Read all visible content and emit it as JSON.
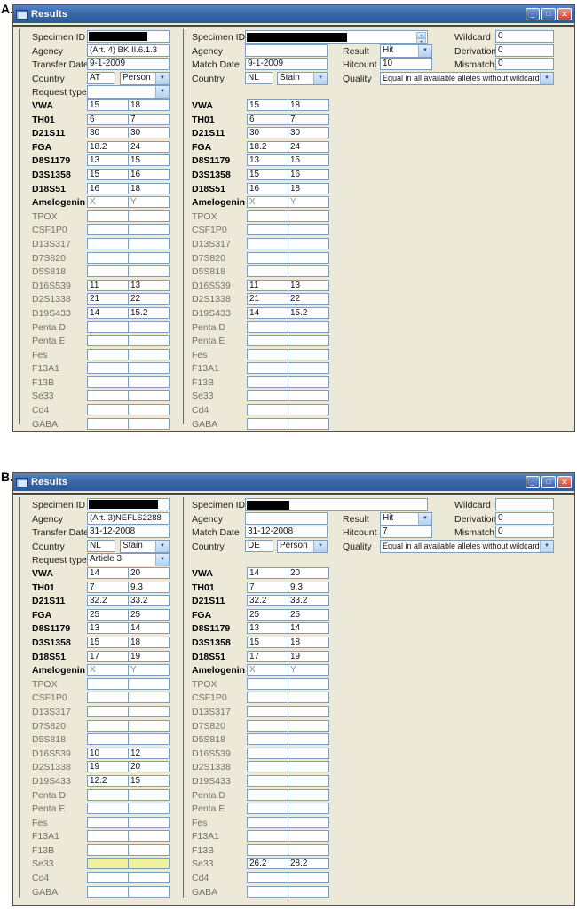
{
  "figure": {
    "label_a": "A.",
    "label_b": "B."
  },
  "icons": {
    "window": "",
    "minimize": "_",
    "maximize": "□",
    "close": "✕",
    "dropdown": "▼",
    "spin_up": "▲",
    "spin_down": "▼"
  },
  "colors": {
    "client_bg": "#ECE9D8",
    "field_border": "#7F9DB9",
    "titlebar_blue": "#3A68A8",
    "highlight_yellow": "#F2F29A",
    "close_red": "#C8473A"
  },
  "windows": [
    {
      "title": "Results",
      "left_panel": {
        "labels": {
          "specimen": "Specimen ID",
          "agency": "Agency",
          "date": "Transfer Date",
          "country": "Country",
          "request": "Request type"
        },
        "values": {
          "specimen": "",
          "agency": "(Art. 4) BK II.6.1.3",
          "date": "9-1-2009",
          "country_code": "AT",
          "country_type": "Person",
          "request": ""
        },
        "loci": [
          {
            "n": "VWA",
            "a1": "15",
            "a2": "18",
            "b": 1
          },
          {
            "n": "TH01",
            "a1": "6",
            "a2": "7",
            "b": 1
          },
          {
            "n": "D21S11",
            "a1": "30",
            "a2": "30",
            "b": 1
          },
          {
            "n": "FGA",
            "a1": "18.2",
            "a2": "24",
            "b": 1
          },
          {
            "n": "D8S1179",
            "a1": "13",
            "a2": "15",
            "b": 1
          },
          {
            "n": "D3S1358",
            "a1": "15",
            "a2": "16",
            "b": 1
          },
          {
            "n": "D18S51",
            "a1": "16",
            "a2": "18",
            "b": 1
          },
          {
            "n": "Amelogenin",
            "a1": "X",
            "a2": "Y",
            "b": 1,
            "m": 1
          },
          {
            "n": "TPOX",
            "a1": "",
            "a2": ""
          },
          {
            "n": "CSF1P0",
            "a1": "",
            "a2": ""
          },
          {
            "n": "D13S317",
            "a1": "",
            "a2": ""
          },
          {
            "n": "D7S820",
            "a1": "",
            "a2": ""
          },
          {
            "n": "D5S818",
            "a1": "",
            "a2": ""
          },
          {
            "n": "D16S539",
            "a1": "11",
            "a2": "13"
          },
          {
            "n": "D2S1338",
            "a1": "21",
            "a2": "22"
          },
          {
            "n": "D19S433",
            "a1": "14",
            "a2": "15.2"
          },
          {
            "n": "Penta D",
            "a1": "",
            "a2": ""
          },
          {
            "n": "Penta E",
            "a1": "",
            "a2": ""
          },
          {
            "n": "Fes",
            "a1": "",
            "a2": ""
          },
          {
            "n": "F13A1",
            "a1": "",
            "a2": ""
          },
          {
            "n": "F13B",
            "a1": "",
            "a2": ""
          },
          {
            "n": "Se33",
            "a1": "",
            "a2": ""
          },
          {
            "n": "Cd4",
            "a1": "",
            "a2": ""
          },
          {
            "n": "GABA",
            "a1": "",
            "a2": ""
          }
        ]
      },
      "right_panel": {
        "labels": {
          "specimen": "Specimen ID",
          "agency": "Agency",
          "date": "Match Date",
          "country": "Country"
        },
        "values": {
          "specimen": "",
          "agency": "",
          "date": "9-1-2009",
          "country_code": "NL",
          "country_type": "Stain"
        },
        "loci": [
          {
            "n": "VWA",
            "a1": "15",
            "a2": "18",
            "b": 1
          },
          {
            "n": "TH01",
            "a1": "6",
            "a2": "7",
            "b": 1
          },
          {
            "n": "D21S11",
            "a1": "30",
            "a2": "30",
            "b": 1
          },
          {
            "n": "FGA",
            "a1": "18.2",
            "a2": "24",
            "b": 1
          },
          {
            "n": "D8S1179",
            "a1": "13",
            "a2": "15",
            "b": 1
          },
          {
            "n": "D3S1358",
            "a1": "15",
            "a2": "16",
            "b": 1
          },
          {
            "n": "D18S51",
            "a1": "16",
            "a2": "18",
            "b": 1
          },
          {
            "n": "Amelogenin",
            "a1": "X",
            "a2": "Y",
            "b": 1,
            "m": 1
          },
          {
            "n": "TPOX",
            "a1": "",
            "a2": ""
          },
          {
            "n": "CSF1P0",
            "a1": "",
            "a2": ""
          },
          {
            "n": "D13S317",
            "a1": "",
            "a2": ""
          },
          {
            "n": "D7S820",
            "a1": "",
            "a2": ""
          },
          {
            "n": "D5S818",
            "a1": "",
            "a2": ""
          },
          {
            "n": "D16S539",
            "a1": "11",
            "a2": "13"
          },
          {
            "n": "D2S1338",
            "a1": "21",
            "a2": "22"
          },
          {
            "n": "D19S433",
            "a1": "14",
            "a2": "15.2"
          },
          {
            "n": "Penta D",
            "a1": "",
            "a2": ""
          },
          {
            "n": "Penta E",
            "a1": "",
            "a2": ""
          },
          {
            "n": "Fes",
            "a1": "",
            "a2": ""
          },
          {
            "n": "F13A1",
            "a1": "",
            "a2": ""
          },
          {
            "n": "F13B",
            "a1": "",
            "a2": ""
          },
          {
            "n": "Se33",
            "a1": "",
            "a2": ""
          },
          {
            "n": "Cd4",
            "a1": "",
            "a2": ""
          },
          {
            "n": "GABA",
            "a1": "",
            "a2": ""
          }
        ]
      },
      "match_panel": {
        "labels": {
          "result": "Result",
          "hitcount": "Hitcount",
          "quality": "Quality",
          "wildcard": "Wildcard",
          "derivation": "Derivation",
          "mismatch": "Mismatch"
        },
        "values": {
          "result": "Hit",
          "hitcount": "10",
          "quality": "Equal in all available alleles without wildcards",
          "wildcard": "0",
          "derivation": "0",
          "mismatch": "0"
        }
      }
    },
    {
      "title": "Results",
      "left_panel": {
        "labels": {
          "specimen": "Specimen ID",
          "agency": "Agency",
          "date": "Transfer Date",
          "country": "Country",
          "request": "Request type"
        },
        "values": {
          "specimen": "",
          "agency": "(Art. 3)NEFLS2288",
          "date": "31-12-2008",
          "country_code": "NL",
          "country_type": "Stain",
          "request": "Article 3"
        },
        "loci": [
          {
            "n": "VWA",
            "a1": "14",
            "a2": "20",
            "b": 1
          },
          {
            "n": "TH01",
            "a1": "7",
            "a2": "9.3",
            "b": 1
          },
          {
            "n": "D21S11",
            "a1": "32.2",
            "a2": "33.2",
            "b": 1
          },
          {
            "n": "FGA",
            "a1": "25",
            "a2": "25",
            "b": 1
          },
          {
            "n": "D8S1179",
            "a1": "13",
            "a2": "14",
            "b": 1
          },
          {
            "n": "D3S1358",
            "a1": "15",
            "a2": "18",
            "b": 1
          },
          {
            "n": "D18S51",
            "a1": "17",
            "a2": "19",
            "b": 1
          },
          {
            "n": "Amelogenin",
            "a1": "X",
            "a2": "Y",
            "b": 1,
            "m": 1
          },
          {
            "n": "TPOX",
            "a1": "",
            "a2": ""
          },
          {
            "n": "CSF1P0",
            "a1": "",
            "a2": ""
          },
          {
            "n": "D13S317",
            "a1": "",
            "a2": ""
          },
          {
            "n": "D7S820",
            "a1": "",
            "a2": ""
          },
          {
            "n": "D5S818",
            "a1": "",
            "a2": ""
          },
          {
            "n": "D16S539",
            "a1": "10",
            "a2": "12"
          },
          {
            "n": "D2S1338",
            "a1": "19",
            "a2": "20"
          },
          {
            "n": "D19S433",
            "a1": "12.2",
            "a2": "15"
          },
          {
            "n": "Penta D",
            "a1": "",
            "a2": ""
          },
          {
            "n": "Penta E",
            "a1": "",
            "a2": ""
          },
          {
            "n": "Fes",
            "a1": "",
            "a2": ""
          },
          {
            "n": "F13A1",
            "a1": "",
            "a2": ""
          },
          {
            "n": "F13B",
            "a1": "",
            "a2": ""
          },
          {
            "n": "Se33",
            "a1": "",
            "a2": "",
            "hl": 1
          },
          {
            "n": "Cd4",
            "a1": "",
            "a2": ""
          },
          {
            "n": "GABA",
            "a1": "",
            "a2": ""
          }
        ]
      },
      "right_panel": {
        "labels": {
          "specimen": "Specimen ID",
          "agency": "Agency",
          "date": "Match Date",
          "country": "Country"
        },
        "values": {
          "specimen": "",
          "agency": "",
          "date": "31-12-2008",
          "country_code": "DE",
          "country_type": "Person"
        },
        "loci": [
          {
            "n": "VWA",
            "a1": "14",
            "a2": "20",
            "b": 1
          },
          {
            "n": "TH01",
            "a1": "7",
            "a2": "9.3",
            "b": 1
          },
          {
            "n": "D21S11",
            "a1": "32.2",
            "a2": "33.2",
            "b": 1
          },
          {
            "n": "FGA",
            "a1": "25",
            "a2": "25",
            "b": 1
          },
          {
            "n": "D8S1179",
            "a1": "13",
            "a2": "14",
            "b": 1
          },
          {
            "n": "D3S1358",
            "a1": "15",
            "a2": "18",
            "b": 1
          },
          {
            "n": "D18S51",
            "a1": "17",
            "a2": "19",
            "b": 1
          },
          {
            "n": "Amelogenin",
            "a1": "X",
            "a2": "Y",
            "b": 1,
            "m": 1
          },
          {
            "n": "TPOX",
            "a1": "",
            "a2": ""
          },
          {
            "n": "CSF1P0",
            "a1": "",
            "a2": ""
          },
          {
            "n": "D13S317",
            "a1": "",
            "a2": ""
          },
          {
            "n": "D7S820",
            "a1": "",
            "a2": ""
          },
          {
            "n": "D5S818",
            "a1": "",
            "a2": ""
          },
          {
            "n": "D16S539",
            "a1": "",
            "a2": ""
          },
          {
            "n": "D2S1338",
            "a1": "",
            "a2": ""
          },
          {
            "n": "D19S433",
            "a1": "",
            "a2": ""
          },
          {
            "n": "Penta D",
            "a1": "",
            "a2": ""
          },
          {
            "n": "Penta E",
            "a1": "",
            "a2": ""
          },
          {
            "n": "Fes",
            "a1": "",
            "a2": ""
          },
          {
            "n": "F13A1",
            "a1": "",
            "a2": ""
          },
          {
            "n": "F13B",
            "a1": "",
            "a2": ""
          },
          {
            "n": "Se33",
            "a1": "26.2",
            "a2": "28.2"
          },
          {
            "n": "Cd4",
            "a1": "",
            "a2": ""
          },
          {
            "n": "GABA",
            "a1": "",
            "a2": ""
          }
        ]
      },
      "match_panel": {
        "labels": {
          "result": "Result",
          "hitcount": "Hitcount",
          "quality": "Quality",
          "wildcard": "Wildcard",
          "derivation": "Derivation",
          "mismatch": "Mismatch"
        },
        "values": {
          "result": "Hit",
          "hitcount": "7",
          "quality": "Equal in all available alleles without wildcards",
          "wildcard": "",
          "derivation": "0",
          "mismatch": "0"
        }
      }
    }
  ]
}
